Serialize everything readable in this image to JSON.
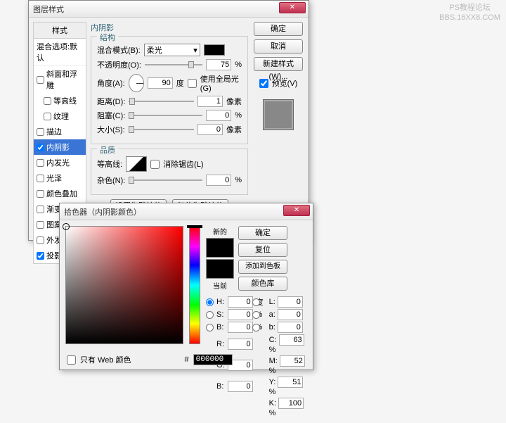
{
  "watermark": {
    "line1": "PS教程论坛",
    "line2": "BBS.16XX8.COM"
  },
  "layerStyle": {
    "title": "图层样式",
    "stylesHeader": "样式",
    "blendDefault": "混合选项:默认",
    "items": [
      {
        "label": "斜面和浮雕",
        "checked": false
      },
      {
        "label": "等高线",
        "checked": false,
        "indent": true
      },
      {
        "label": "纹理",
        "checked": false,
        "indent": true
      },
      {
        "label": "描边",
        "checked": false
      },
      {
        "label": "内阴影",
        "checked": true,
        "selected": true
      },
      {
        "label": "内发光",
        "checked": false
      },
      {
        "label": "光泽",
        "checked": false
      },
      {
        "label": "颜色叠加",
        "checked": false
      },
      {
        "label": "渐变叠加",
        "checked": false
      },
      {
        "label": "图案叠加",
        "checked": false
      },
      {
        "label": "外发光",
        "checked": false
      },
      {
        "label": "投影",
        "checked": true
      }
    ],
    "panelTitle": "内阴影",
    "structureTitle": "结构",
    "blendModeLabel": "混合模式(B):",
    "blendModeValue": "柔光",
    "opacityLabel": "不透明度(O):",
    "opacityValue": "75",
    "angleLabel": "角度(A):",
    "angleValue": "90",
    "angleUnit": "度",
    "globalLightLabel": "使用全局光(G)",
    "distanceLabel": "距离(D):",
    "distanceValue": "1",
    "distanceUnit": "像素",
    "chokeLabel": "阻塞(C):",
    "chokeValue": "0",
    "sizeLabel": "大小(S):",
    "sizeValue": "0",
    "sizeUnit": "像素",
    "qualityTitle": "品质",
    "contourLabel": "等高线:",
    "antiAliasLabel": "消除锯齿(L)",
    "noiseLabel": "杂色(N):",
    "noiseValue": "0",
    "percent": "%",
    "resetDefault": "设置为默认值",
    "restoreDefault": "复位为默认值",
    "ok": "确定",
    "cancel": "取消",
    "newStyle": "新建样式(W)...",
    "previewLabel": "预览(V)"
  },
  "colorPicker": {
    "title": "拾色器（内阴影颜色）",
    "newLabel": "新的",
    "currentLabel": "当前",
    "ok": "确定",
    "cancel": "复位",
    "addSwatch": "添加到色板",
    "colorLib": "颜色库",
    "webOnly": "只有 Web 颜色",
    "H": "H:",
    "Hv": "0",
    "Hu": "度",
    "S": "S:",
    "Sv": "0",
    "Bb": "B:",
    "Bbv": "0",
    "L": "L:",
    "Lv": "0",
    "a": "a:",
    "av": "0",
    "b": "b:",
    "bv": "0",
    "R": "R:",
    "Rv": "0",
    "G": "G:",
    "Gv": "0",
    "Bc": "B:",
    "Bcv": "0",
    "C": "C:",
    "Cv": "63",
    "M": "M:",
    "Mv": "52",
    "Y": "Y:",
    "Yv": "51",
    "K": "K:",
    "Kv": "100",
    "pct": "%",
    "hex": "000000",
    "hash": "#"
  }
}
